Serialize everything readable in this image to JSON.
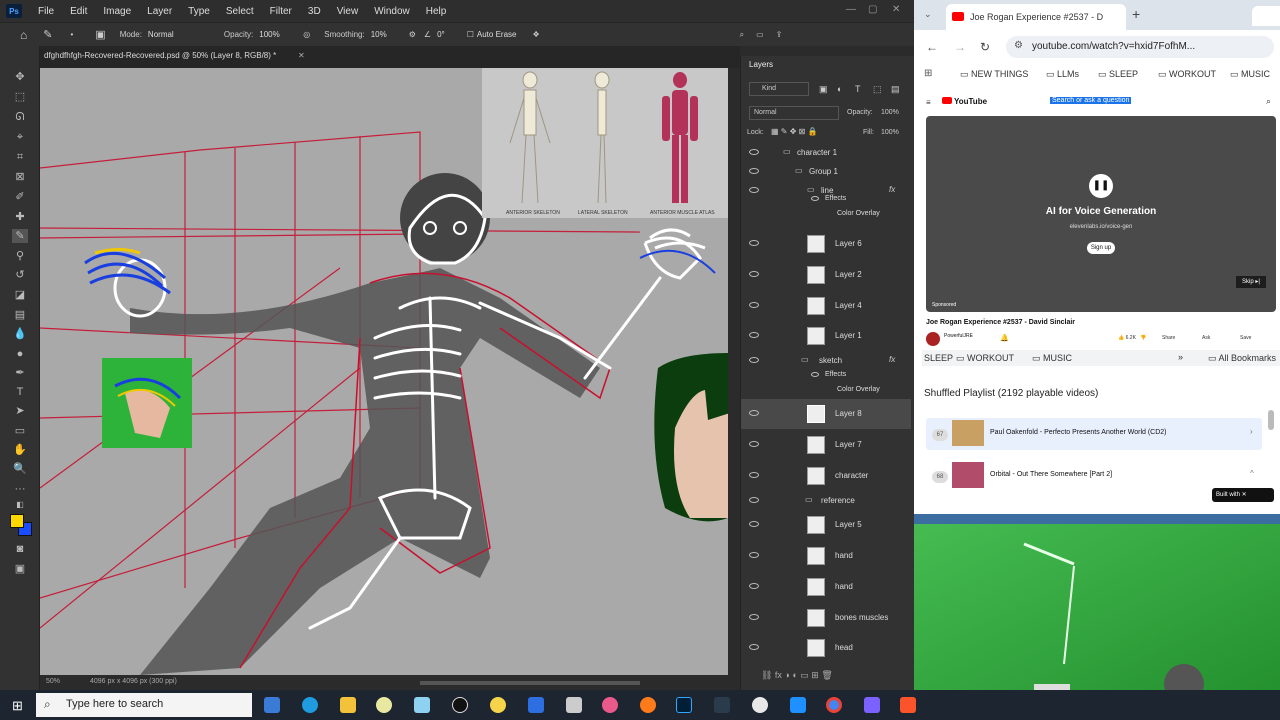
{
  "photoshop": {
    "logo": "Ps",
    "menu": [
      "File",
      "Edit",
      "Image",
      "Layer",
      "Type",
      "Select",
      "Filter",
      "3D",
      "View",
      "Window",
      "Help"
    ],
    "options": {
      "mode_label": "Mode:",
      "mode_value": "Normal",
      "opacity_label": "Opacity:",
      "opacity_value": "100%",
      "smoothing_label": "Smoothing:",
      "smoothing_value": "10%",
      "angle_value": "0°",
      "auto_erase": "Auto Erase"
    },
    "document_tab": "dfghdfhfgh-Recovered-Recovered.psd @ 50% (Layer 8, RGB/8) *",
    "status_zoom": "50%",
    "status_info": "4096 px x 4096 px (300 ppi)",
    "reference_labels": [
      "ANTERIOR SKELETON",
      "LATERAL SKELETON",
      "ANTERIOR MUSCLE ATLAS"
    ]
  },
  "layers_panel": {
    "title": "Layers",
    "filter_kind": "Kind",
    "blend_mode": "Normal",
    "opacity_label": "Opacity:",
    "opacity_value": "100%",
    "lock_label": "Lock:",
    "fill_label": "Fill:",
    "fill_value": "100%",
    "layers": [
      {
        "name": "character 1",
        "type": "group"
      },
      {
        "name": "Group 1",
        "type": "group"
      },
      {
        "name": "line",
        "type": "group"
      },
      {
        "name": "Effects",
        "type": "effect"
      },
      {
        "name": "Color Overlay",
        "type": "effect"
      },
      {
        "name": "Layer 6",
        "type": "layer"
      },
      {
        "name": "Layer 2",
        "type": "layer"
      },
      {
        "name": "Layer 4",
        "type": "layer"
      },
      {
        "name": "Layer 1",
        "type": "layer"
      },
      {
        "name": "sketch",
        "type": "group"
      },
      {
        "name": "Effects",
        "type": "effect"
      },
      {
        "name": "Color Overlay",
        "type": "effect"
      },
      {
        "name": "Layer 8",
        "type": "layer"
      },
      {
        "name": "Layer 7",
        "type": "layer"
      },
      {
        "name": "character",
        "type": "layer"
      },
      {
        "name": "reference",
        "type": "group"
      },
      {
        "name": "Layer 5",
        "type": "layer"
      },
      {
        "name": "hand",
        "type": "layer"
      },
      {
        "name": "hand",
        "type": "layer"
      },
      {
        "name": "bones muscles",
        "type": "layer"
      },
      {
        "name": "head",
        "type": "layer"
      }
    ]
  },
  "chrome": {
    "tab_title": "Joe Rogan Experience #2537 - D",
    "url": "youtube.com/watch?v=hxid7FofhM...",
    "bookmarks": [
      "NEW THINGS",
      "LLMs",
      "SLEEP",
      "WORKOUT",
      "MUSIC"
    ],
    "youtube_logo": "YouTube",
    "search_placeholder": "Search or ask a question",
    "ad_title": "AI for Voice Generation",
    "ad_url": "elevenlabs.io/voice-gen",
    "ad_cta": "Sign up",
    "skip": "Skip",
    "sponsored": "Sponsored",
    "video_title": "Joe Rogan Experience #2537 - David Sinclair",
    "channel": "PowerfulJRE",
    "likes": "6.2K",
    "share": "Share",
    "ask": "Ask",
    "save": "Save"
  },
  "chrome_lower": {
    "bookmarks": [
      "SLEEP",
      "WORKOUT",
      "MUSIC"
    ],
    "all_bookmarks": "All Bookmarks",
    "playlist_title": "Shuffled Playlist (2192 playable videos)",
    "items": [
      {
        "num": "67",
        "title": "Paul Oakenfold - Perfecto Presents Another World (CD2)"
      },
      {
        "num": "68",
        "title": "Orbital - Out There Somewhere [Part 2]"
      }
    ],
    "built_with": "Built with"
  },
  "taskbar": {
    "search_placeholder": "Type here to search"
  }
}
